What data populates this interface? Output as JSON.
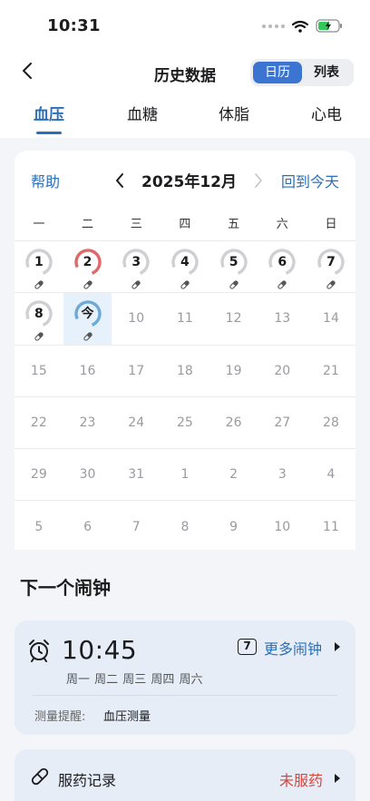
{
  "status_bar": {
    "time": "10:31"
  },
  "nav": {
    "title": "历史数据",
    "segments": [
      "日历",
      "列表"
    ],
    "active_segment": 0
  },
  "tabs": [
    {
      "label": "血压",
      "active": true
    },
    {
      "label": "血糖",
      "active": false
    },
    {
      "label": "体脂",
      "active": false
    },
    {
      "label": "心电",
      "active": false
    }
  ],
  "calendar": {
    "help": "帮助",
    "month": "2025年12月",
    "back_to_today": "回到今天",
    "weekdays": [
      "一",
      "二",
      "三",
      "四",
      "五",
      "六",
      "日"
    ],
    "rows": [
      [
        {
          "label": "1",
          "ring": "gray",
          "pill": true
        },
        {
          "label": "2",
          "ring": "red",
          "pill": true
        },
        {
          "label": "3",
          "ring": "gray",
          "pill": true
        },
        {
          "label": "4",
          "ring": "gray",
          "pill": true
        },
        {
          "label": "5",
          "ring": "gray",
          "pill": true
        },
        {
          "label": "6",
          "ring": "gray",
          "pill": true
        },
        {
          "label": "7",
          "ring": "gray",
          "pill": true
        }
      ],
      [
        {
          "label": "8",
          "ring": "gray",
          "pill": true
        },
        {
          "label": "今",
          "ring": "blue",
          "pill": true,
          "today": true
        },
        {
          "label": "10"
        },
        {
          "label": "11"
        },
        {
          "label": "12"
        },
        {
          "label": "13"
        },
        {
          "label": "14"
        }
      ],
      [
        {
          "label": "15"
        },
        {
          "label": "16"
        },
        {
          "label": "17"
        },
        {
          "label": "18"
        },
        {
          "label": "19"
        },
        {
          "label": "20"
        },
        {
          "label": "21"
        }
      ],
      [
        {
          "label": "22"
        },
        {
          "label": "23"
        },
        {
          "label": "24"
        },
        {
          "label": "25"
        },
        {
          "label": "26"
        },
        {
          "label": "27"
        },
        {
          "label": "28"
        }
      ],
      [
        {
          "label": "29"
        },
        {
          "label": "30"
        },
        {
          "label": "31"
        },
        {
          "label": "1"
        },
        {
          "label": "2"
        },
        {
          "label": "3"
        },
        {
          "label": "4"
        }
      ],
      [
        {
          "label": "5"
        },
        {
          "label": "6"
        },
        {
          "label": "7"
        },
        {
          "label": "8"
        },
        {
          "label": "9"
        },
        {
          "label": "10"
        },
        {
          "label": "11"
        }
      ]
    ]
  },
  "next_alarm": {
    "section_title": "下一个闹钟",
    "time": "10:45",
    "days": "周一 周二 周三 周四 周六",
    "count": "7",
    "more_label": "更多闹钟",
    "remind_label": "测量提醒:",
    "remind_value": "血压测量"
  },
  "medication": {
    "label": "服药记录",
    "status": "未服药"
  },
  "colors": {
    "accent": "#2a6fb8",
    "segment_active": "#3b74d1",
    "ring_gray": "#cfd0d4",
    "ring_red": "#e0676a",
    "ring_blue": "#6fa9d6",
    "warning": "#d8453b"
  },
  "icons": {
    "back": "chevron-left-icon",
    "prev_month": "chevron-left-icon",
    "next_month": "chevron-right-icon",
    "alarm": "alarm-clock-icon",
    "pill": "pill-icon",
    "wifi": "wifi-icon",
    "battery": "battery-charging-icon"
  }
}
